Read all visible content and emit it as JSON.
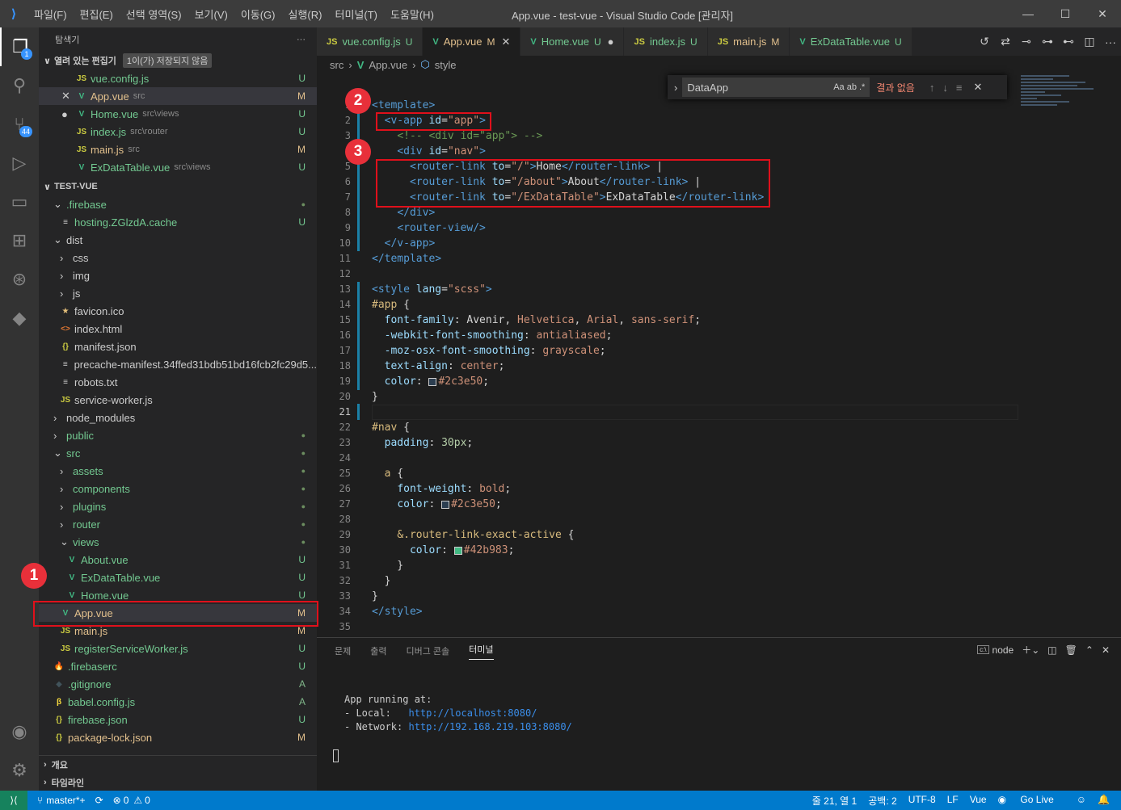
{
  "title_bar": {
    "menus": [
      "파일(F)",
      "편집(E)",
      "선택 영역(S)",
      "보기(V)",
      "이동(G)",
      "실행(R)",
      "터미널(T)",
      "도움말(H)"
    ],
    "window_title": "App.vue - test-vue - Visual Studio Code [관리자]"
  },
  "activity": {
    "explorer_badge": "1",
    "scm_badge": "44"
  },
  "sidebar": {
    "title": "탐색기",
    "open_editors_label": "열려 있는 편집기",
    "unsaved_label": "1이(가) 저장되지 않음",
    "open_editors": [
      {
        "icon": "JS",
        "name": "vue.config.js",
        "desc": "",
        "status": "U"
      },
      {
        "icon": "V",
        "name": "App.vue",
        "desc": "src",
        "status": "M"
      },
      {
        "icon": "V",
        "name": "Home.vue",
        "desc": "src\\views",
        "status": "U"
      },
      {
        "icon": "JS",
        "name": "index.js",
        "desc": "src\\router",
        "status": "U"
      },
      {
        "icon": "JS",
        "name": "main.js",
        "desc": "src",
        "status": "M"
      },
      {
        "icon": "V",
        "name": "ExDataTable.vue",
        "desc": "src\\views",
        "status": "U"
      }
    ],
    "project_label": "TEST-VUE",
    "tree": [
      {
        "name": ".firebase",
        "status": "●"
      },
      {
        "name": "hosting.ZGlzdA.cache",
        "status": "U"
      },
      {
        "name": "dist",
        "status": ""
      },
      {
        "name": "css",
        "status": ""
      },
      {
        "name": "img",
        "status": ""
      },
      {
        "name": "js",
        "status": ""
      },
      {
        "name": "favicon.ico",
        "status": ""
      },
      {
        "name": "index.html",
        "status": ""
      },
      {
        "name": "manifest.json",
        "status": ""
      },
      {
        "name": "precache-manifest.34ffed31bdb51bd16fcb2fc29d5...",
        "status": ""
      },
      {
        "name": "robots.txt",
        "status": ""
      },
      {
        "name": "service-worker.js",
        "status": ""
      },
      {
        "name": "node_modules",
        "status": ""
      },
      {
        "name": "public",
        "status": "●"
      },
      {
        "name": "src",
        "status": "●"
      },
      {
        "name": "assets",
        "status": "●"
      },
      {
        "name": "components",
        "status": "●"
      },
      {
        "name": "plugins",
        "status": "●"
      },
      {
        "name": "router",
        "status": "●"
      },
      {
        "name": "views",
        "status": "●"
      },
      {
        "name": "About.vue",
        "status": "U"
      },
      {
        "name": "ExDataTable.vue",
        "status": "U"
      },
      {
        "name": "Home.vue",
        "status": "U"
      },
      {
        "name": "App.vue",
        "status": "M"
      },
      {
        "name": "main.js",
        "status": "M"
      },
      {
        "name": "registerServiceWorker.js",
        "status": "U"
      },
      {
        "name": ".firebaserc",
        "status": "U"
      },
      {
        "name": ".gitignore",
        "status": "A"
      },
      {
        "name": "babel.config.js",
        "status": "A"
      },
      {
        "name": "firebase.json",
        "status": "U"
      },
      {
        "name": "package-lock.json",
        "status": "M"
      }
    ],
    "outline_label": "개요",
    "timeline_label": "타임라인"
  },
  "tabs": [
    {
      "icon": "JS",
      "name": "vue.config.js",
      "status": "U"
    },
    {
      "icon": "V",
      "name": "App.vue",
      "status": "M"
    },
    {
      "icon": "V",
      "name": "Home.vue",
      "status": "U"
    },
    {
      "icon": "JS",
      "name": "index.js",
      "status": "U"
    },
    {
      "icon": "JS",
      "name": "main.js",
      "status": "M"
    },
    {
      "icon": "V",
      "name": "ExDataTable.vue",
      "status": "U"
    }
  ],
  "breadcrumb": [
    "src",
    "App.vue",
    "style"
  ],
  "find": {
    "query": "DataApp",
    "result": "결과 없음",
    "opts": "Aa  ab  .*"
  },
  "editor": {
    "current_line": "21",
    "line_numbers": [
      "1",
      "2",
      "3",
      "4",
      "5",
      "6",
      "7",
      "8",
      "9",
      "10",
      "11",
      "12",
      "13",
      "14",
      "15",
      "16",
      "17",
      "18",
      "19",
      "20",
      "21",
      "22",
      "23",
      "24",
      "25",
      "26",
      "27",
      "28",
      "29",
      "30",
      "31",
      "32",
      "33",
      "34",
      "35"
    ]
  },
  "panel": {
    "tabs": [
      "문제",
      "출력",
      "디버그 콘솔",
      "터미널"
    ],
    "terminal_select": "node",
    "terminal": {
      "line1": "App running at:",
      "local_label": "- Local:   ",
      "local_url": "http://localhost:8080/",
      "network_label": "- Network: ",
      "network_url": "http://192.168.219.103:8080/"
    }
  },
  "status": {
    "branch": "master*+",
    "errors": "0",
    "warnings": "0",
    "position": "줄 21, 열 1",
    "spaces": "공백: 2",
    "encoding": "UTF-8",
    "eol": "LF",
    "language": "Vue",
    "golive": "Go Live"
  },
  "annotations": [
    "1",
    "2",
    "3"
  ],
  "colors": {
    "accent": "#007acc",
    "annotation": "#e0101b"
  }
}
